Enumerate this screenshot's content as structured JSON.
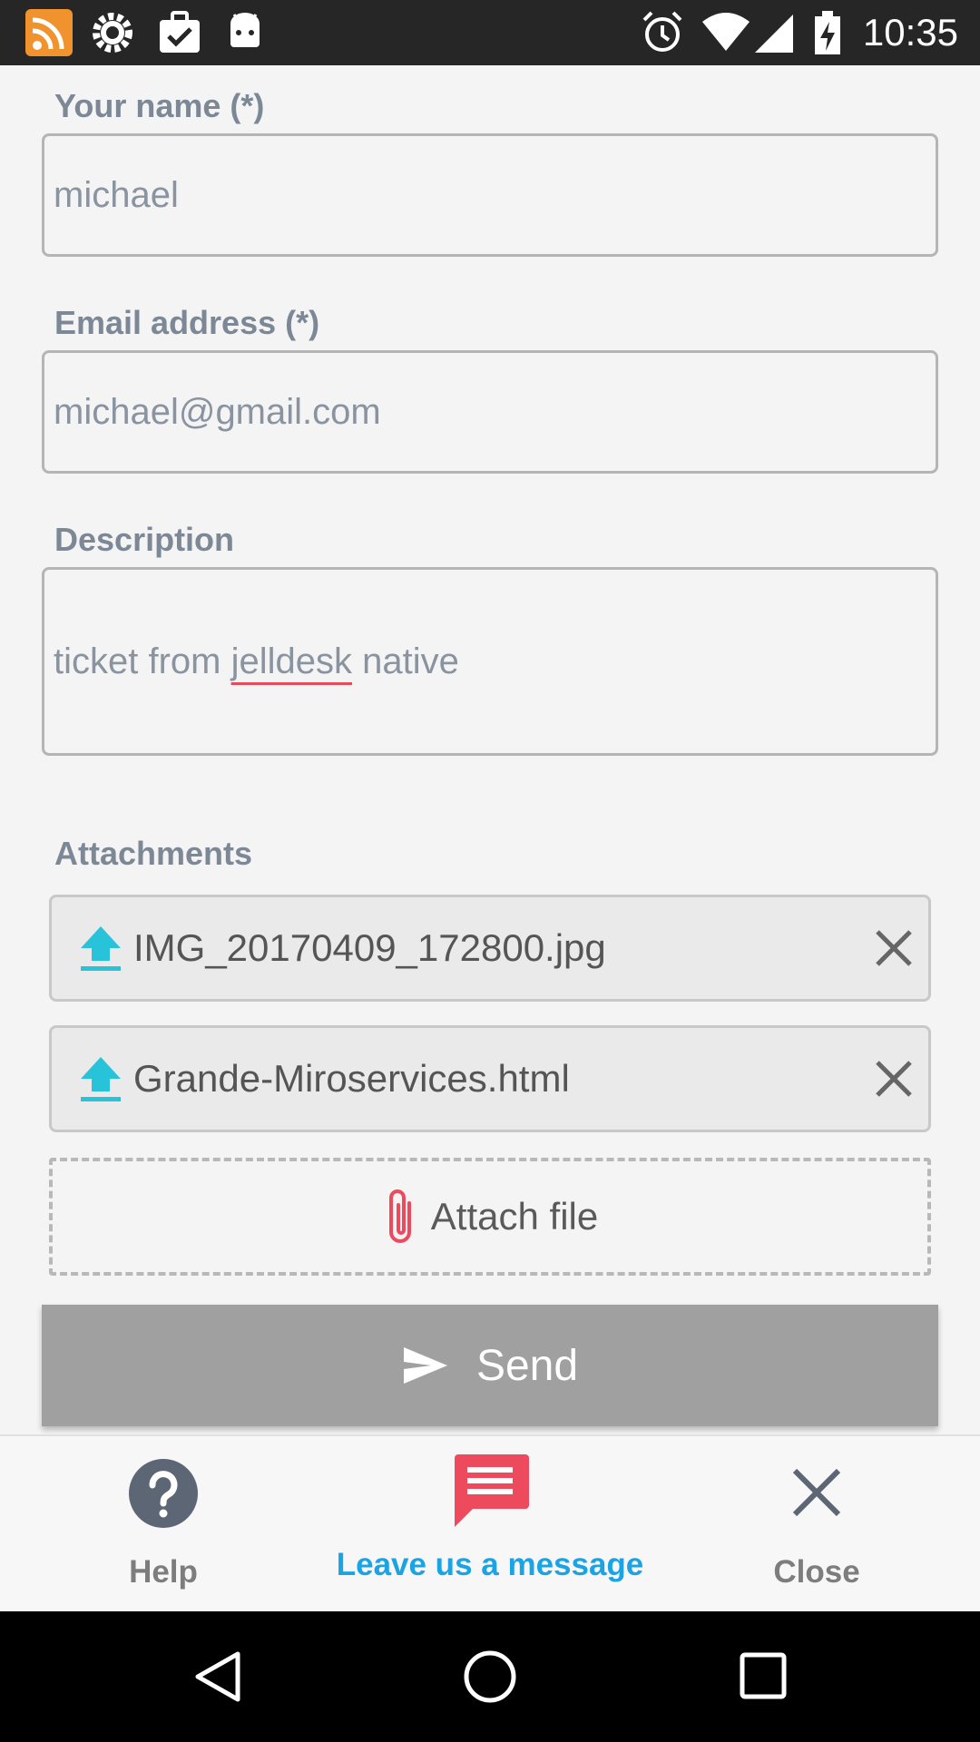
{
  "status_bar": {
    "time": "10:35",
    "left_icons": [
      "rss-app-icon",
      "settings-gear-icon",
      "briefcase-check-icon",
      "android-icon"
    ],
    "right_icons": [
      "alarm-icon",
      "wifi-icon",
      "cell-signal-icon",
      "battery-charging-icon"
    ]
  },
  "form": {
    "name": {
      "label": "Your name (*)",
      "value": "michael"
    },
    "email": {
      "label": "Email address (*)",
      "value": "michael@gmail.com"
    },
    "description": {
      "label": "Description",
      "value_before": "ticket from ",
      "value_misspelled": "jelldesk",
      "value_after": " native"
    },
    "attachments": {
      "label": "Attachments",
      "files": [
        "IMG_20170409_172800.jpg",
        "Grande-Miroservices.html"
      ],
      "attach_label": "Attach file"
    },
    "send_label": "Send"
  },
  "tabs": {
    "help": "Help",
    "message": "Leave us a message",
    "close": "Close"
  },
  "colors": {
    "accent_blue": "#1ca3e3",
    "accent_red": "#ee4a5e",
    "upload_cyan": "#29c3d9",
    "send_disabled": "#a0a0a0",
    "label_gray": "#7d8896"
  }
}
